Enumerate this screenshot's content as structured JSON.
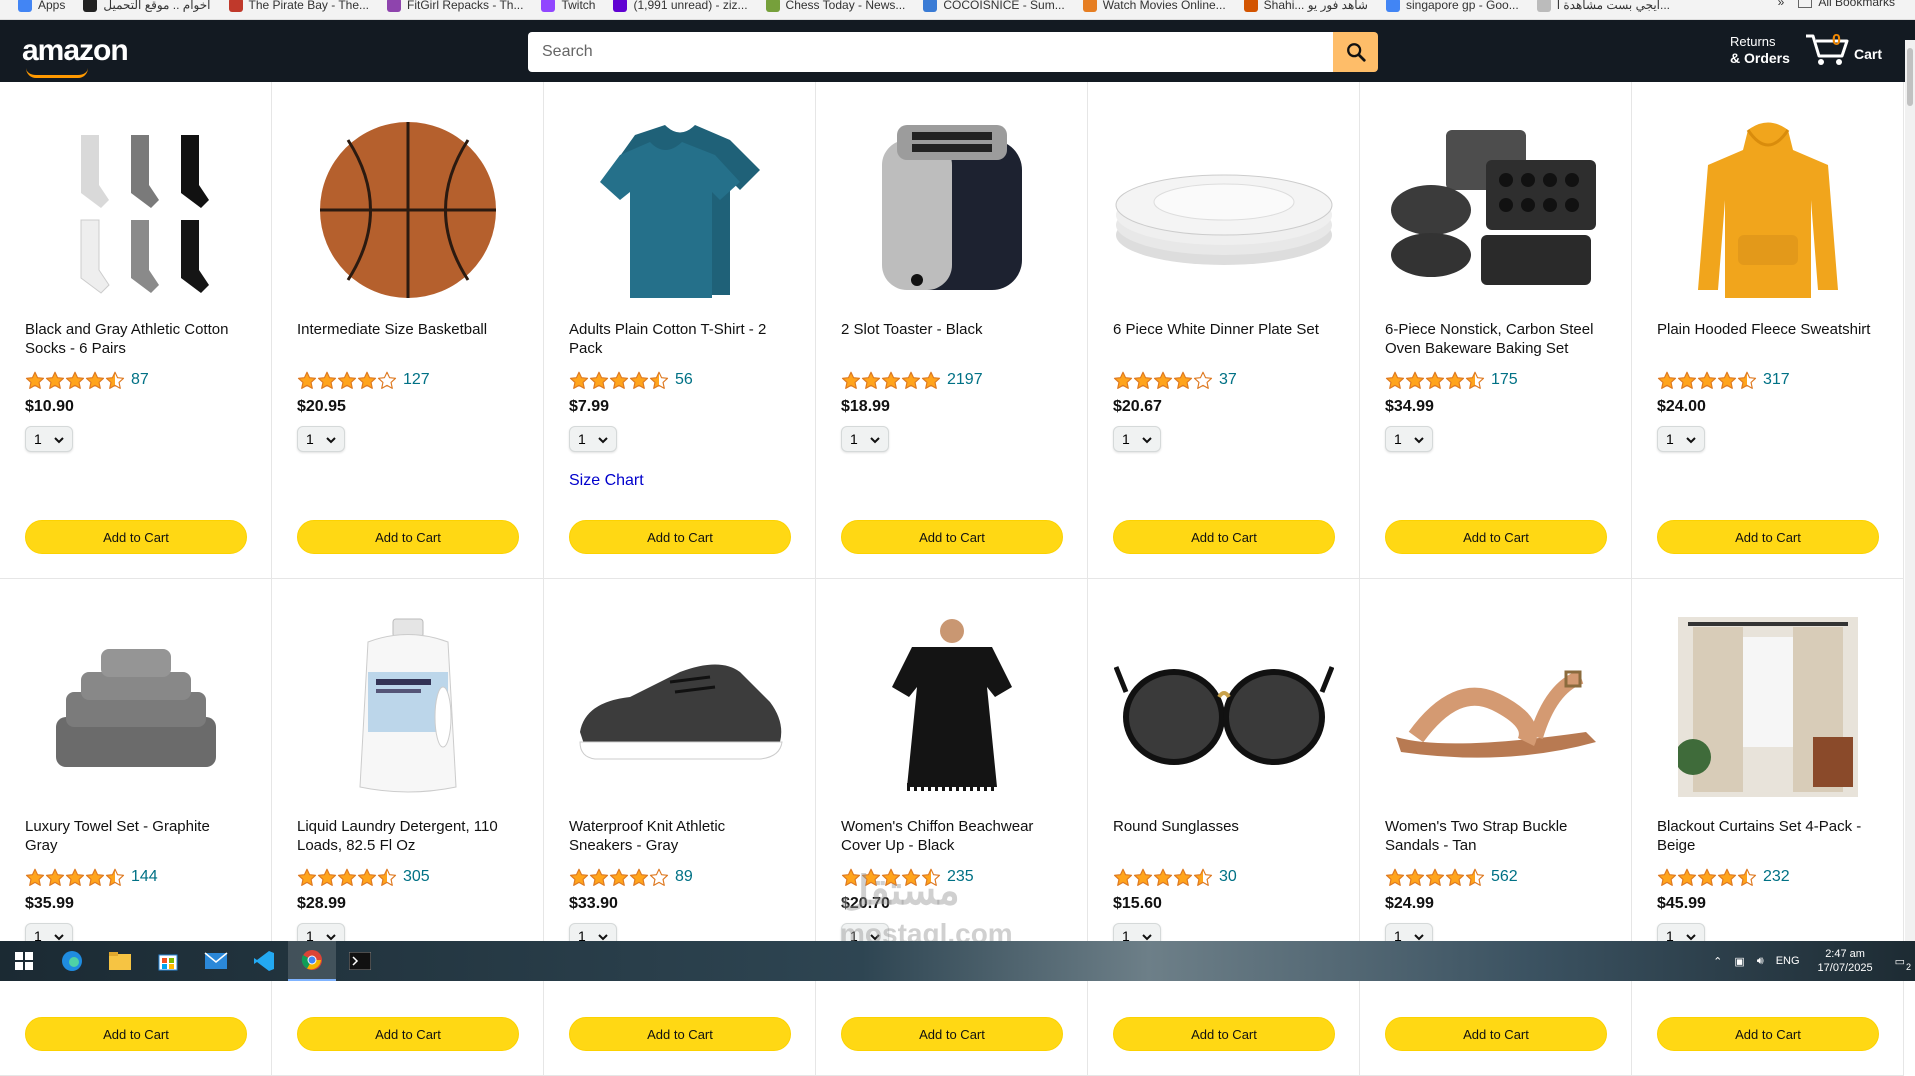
{
  "bookmarks": {
    "items": [
      {
        "label": "Apps",
        "color": "#4285f4"
      },
      {
        "label": "اخوام .. موقع التحميل",
        "color": "#222222"
      },
      {
        "label": "The Pirate Bay - The...",
        "color": "#c0392b"
      },
      {
        "label": "FitGirl Repacks - Th...",
        "color": "#8e44ad"
      },
      {
        "label": "Twitch",
        "color": "#9146ff"
      },
      {
        "label": "(1,991 unread) - ziz...",
        "color": "#6001d2"
      },
      {
        "label": "Chess Today - News...",
        "color": "#76a03b"
      },
      {
        "label": "COCOISNICE - Sum...",
        "color": "#3a7bd5"
      },
      {
        "label": "Watch Movies Online...",
        "color": "#e67e22"
      },
      {
        "label": "Shahi... شاهد فور يو",
        "color": "#d35400"
      },
      {
        "label": "singapore gp - Goo...",
        "color": "#4285f4"
      },
      {
        "label": "ايجي بست مشاهدة ا...",
        "color": "#bbbbbb"
      }
    ],
    "more": "»",
    "all_bookmarks": "All Bookmarks"
  },
  "header": {
    "logo": "amazon",
    "search_placeholder": "Search",
    "returns_line1": "Returns",
    "returns_line2": "& Orders",
    "cart_count": "0",
    "cart_label": "Cart"
  },
  "products": [
    {
      "title": "Black and Gray Athletic Cotton Socks - 6 Pairs",
      "stars": 4.5,
      "rating_count": "87",
      "price": "$10.90",
      "qty": "1",
      "image": "socks"
    },
    {
      "title": "Intermediate Size Basketball",
      "stars": 4.0,
      "rating_count": "127",
      "price": "$20.95",
      "qty": "1",
      "image": "basketball"
    },
    {
      "title": "Adults Plain Cotton T-Shirt - 2 Pack",
      "stars": 4.5,
      "rating_count": "56",
      "price": "$7.99",
      "qty": "1",
      "image": "tshirt",
      "size_chart": "Size Chart"
    },
    {
      "title": "2 Slot Toaster - Black",
      "stars": 5.0,
      "rating_count": "2197",
      "price": "$18.99",
      "qty": "1",
      "image": "toaster"
    },
    {
      "title": "6 Piece White Dinner Plate Set",
      "stars": 4.0,
      "rating_count": "37",
      "price": "$20.67",
      "qty": "1",
      "image": "plates"
    },
    {
      "title": "6-Piece Nonstick, Carbon Steel Oven Bakeware Baking Set",
      "stars": 4.5,
      "rating_count": "175",
      "price": "$34.99",
      "qty": "1",
      "image": "bakeware"
    },
    {
      "title": "Plain Hooded Fleece Sweatshirt",
      "stars": 4.5,
      "rating_count": "317",
      "price": "$24.00",
      "qty": "1",
      "image": "hoodie"
    },
    {
      "title": "Luxury Towel Set - Graphite Gray",
      "stars": 4.5,
      "rating_count": "144",
      "price": "$35.99",
      "qty": "1",
      "image": "towels"
    },
    {
      "title": "Liquid Laundry Detergent, 110 Loads, 82.5 Fl Oz",
      "stars": 4.5,
      "rating_count": "305",
      "price": "$28.99",
      "qty": "1",
      "image": "detergent"
    },
    {
      "title": "Waterproof Knit Athletic Sneakers - Gray",
      "stars": 4.0,
      "rating_count": "89",
      "price": "$33.90",
      "qty": "1",
      "image": "sneakers"
    },
    {
      "title": "Women's Chiffon Beachwear Cover Up - Black",
      "stars": 4.5,
      "rating_count": "235",
      "price": "$20.70",
      "qty": "1",
      "image": "coverup"
    },
    {
      "title": "Round Sunglasses",
      "stars": 4.5,
      "rating_count": "30",
      "price": "$15.60",
      "qty": "1",
      "image": "sunglasses"
    },
    {
      "title": "Women's Two Strap Buckle Sandals - Tan",
      "stars": 4.5,
      "rating_count": "562",
      "price": "$24.99",
      "qty": "1",
      "image": "sandals"
    },
    {
      "title": "Blackout Curtains Set 4-Pack - Beige",
      "stars": 4.5,
      "rating_count": "232",
      "price": "$45.99",
      "qty": "1",
      "image": "curtains"
    }
  ],
  "add_to_cart_label": "Add to Cart",
  "watermark": {
    "line1": "مستقل",
    "line2": "mostaql.com"
  },
  "taskbar": {
    "lang": "ENG",
    "time": "2:47 am",
    "date": "17/07/2025",
    "notif_count": "2"
  },
  "colors": {
    "header_bg": "#131a22",
    "search_button": "#febd69",
    "add_button": "#ffd814",
    "star": "#ffa41c",
    "link": "#007185"
  }
}
